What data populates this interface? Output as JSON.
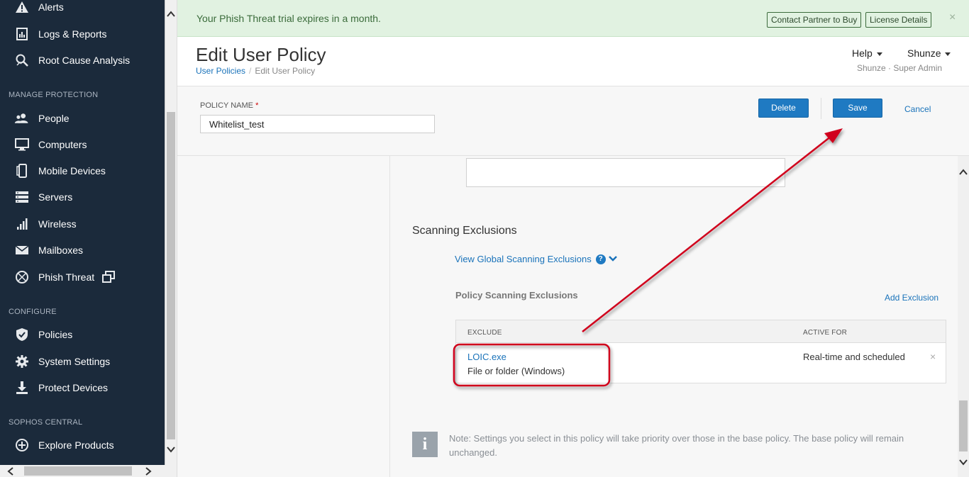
{
  "sidebar": {
    "top_items": [
      {
        "label": "Alerts",
        "icon": "alert-icon"
      },
      {
        "label": "Logs & Reports",
        "icon": "reports-icon"
      },
      {
        "label": "Root Cause Analysis",
        "icon": "root-cause-icon"
      }
    ],
    "manage_heading": "MANAGE PROTECTION",
    "manage_items": [
      {
        "label": "People",
        "icon": "people-icon"
      },
      {
        "label": "Computers",
        "icon": "computer-icon"
      },
      {
        "label": "Mobile Devices",
        "icon": "mobile-icon"
      },
      {
        "label": "Servers",
        "icon": "server-icon"
      },
      {
        "label": "Wireless",
        "icon": "wireless-icon"
      },
      {
        "label": "Mailboxes",
        "icon": "mailbox-icon"
      },
      {
        "label": "Phish Threat",
        "icon": "phish-icon"
      }
    ],
    "configure_heading": "CONFIGURE",
    "configure_items": [
      {
        "label": "Policies",
        "icon": "shield-icon"
      },
      {
        "label": "System Settings",
        "icon": "gear-icon"
      },
      {
        "label": "Protect Devices",
        "icon": "download-icon"
      }
    ],
    "central_heading": "SOPHOS CENTRAL",
    "central_items": [
      {
        "label": "Explore Products",
        "icon": "plus-circle-icon"
      }
    ]
  },
  "banner": {
    "text": "Your Phish Threat trial expires in a month.",
    "contact_label": "Contact Partner to Buy",
    "license_label": "License Details",
    "close": "×"
  },
  "header": {
    "title": "Edit User Policy",
    "breadcrumb_parent": "User Policies",
    "breadcrumb_sep": "/",
    "breadcrumb_current": "Edit User Policy",
    "help_label": "Help",
    "user_label": "Shunze",
    "user_role": "Shunze · Super Admin"
  },
  "form": {
    "policy_name_label": "POLICY NAME",
    "required_mark": "*",
    "policy_name_value": "Whitelist_test",
    "delete_label": "Delete",
    "save_label": "Save",
    "cancel_label": "Cancel"
  },
  "content": {
    "section_title": "Scanning Exclusions",
    "global_link": "View Global Scanning Exclusions",
    "help_glyph": "?",
    "policy_excl_title": "Policy Scanning Exclusions",
    "add_exclusion": "Add Exclusion",
    "table": {
      "col_exclude": "EXCLUDE",
      "col_active": "ACTIVE FOR",
      "rows": [
        {
          "name": "LOIC.exe",
          "type": "File or folder (Windows)",
          "active_for": "Real-time and scheduled",
          "delete": "×"
        }
      ]
    },
    "note_icon": "i",
    "note": "Note: Settings you select in this policy will take priority over those in the base policy. The base policy will remain unchanged."
  },
  "colors": {
    "sidebar_bg": "#1b2a3b",
    "accent_blue": "#1f7ac2",
    "banner_bg": "#e1f2e1",
    "annotation_red": "#d0021b"
  }
}
